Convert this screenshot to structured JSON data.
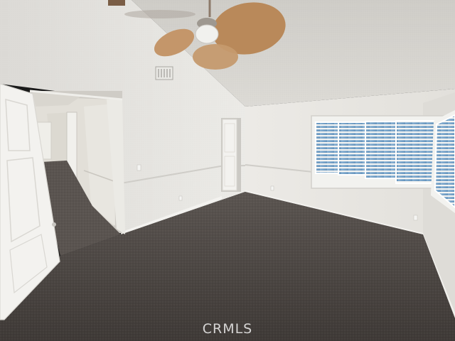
{
  "photo": {
    "subject": "empty-bedroom-interior",
    "colors": {
      "wall": "#e6e4df",
      "ceiling": "#d6d4cf",
      "carpet": "#4b4642",
      "door": "#f2f1ee",
      "window_glass": "#7aa6cc",
      "fan_blade": "#b9895a"
    }
  },
  "watermark": {
    "text": "CRMLS"
  }
}
